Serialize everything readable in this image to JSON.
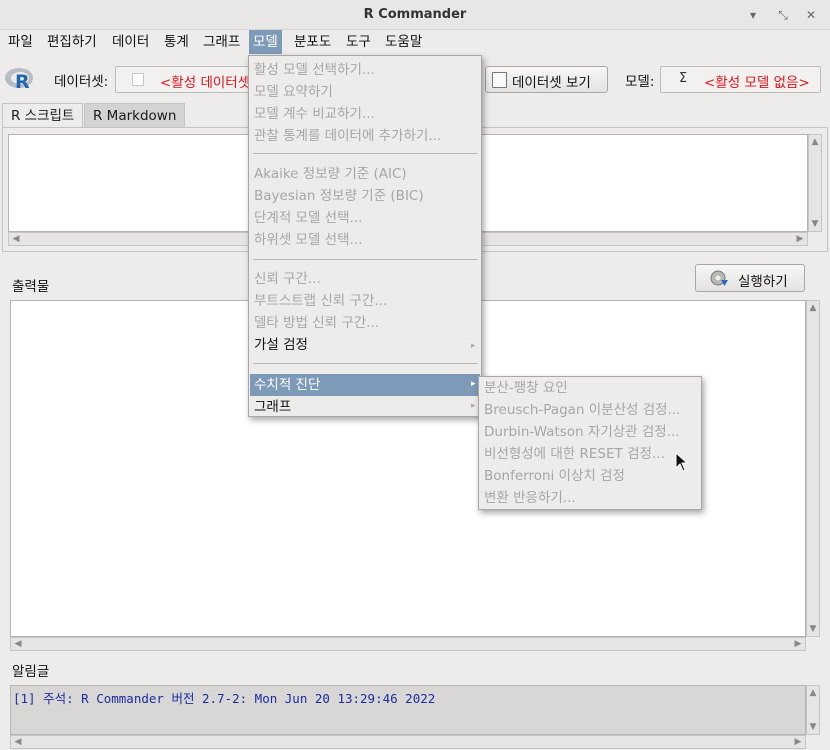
{
  "window": {
    "title": "R Commander",
    "controls": [
      "minimize-icon",
      "restore-icon",
      "close-icon"
    ]
  },
  "menubar": {
    "items": [
      "파일",
      "편집하기",
      "데이터",
      "통계",
      "그래프",
      "모델",
      "분포도",
      "도구",
      "도움말"
    ],
    "active_index": 5
  },
  "toolbar": {
    "dataset_label": "데이터셋:",
    "dataset_value": "<활성 데이터셋 없음>",
    "view_dataset_button": "데이터셋 보기",
    "model_label": "모델:",
    "model_value": "<활성 모델 없음>",
    "model_icon": "Σ"
  },
  "tabs": [
    {
      "label": "R 스크립트",
      "active": true
    },
    {
      "label": "R Markdown",
      "active": false
    }
  ],
  "output": {
    "label": "출력물",
    "run_button": "실행하기"
  },
  "notice": {
    "label": "알림글",
    "message": "[1] 주석: R Commander 버전 2.7-2: Mon Jun 20 13:29:46 2022"
  },
  "model_menu": {
    "groups": [
      [
        "활성 모델 선택하기...",
        "모델 요약하기",
        "모델 계수 비교하기...",
        "관찰 통계를 데이터에 추가하기..."
      ],
      [
        "Akaike 정보량 기준 (AIC)",
        "Bayesian 정보량 기준 (BIC)",
        "단계적 모델 선택...",
        "하위셋 모델 선택..."
      ],
      [
        "신뢰 구간...",
        "부트스트랩 신뢰 구간...",
        "델타 방법 신뢰 구간...",
        "가설 검정"
      ],
      [
        "수치적 진단",
        "그래프"
      ]
    ]
  },
  "diagnostics_submenu": {
    "items": [
      "분산-팽창 요인",
      "Breusch-Pagan 이분산성 검정...",
      "Durbin-Watson 자기상관 검정...",
      "비선형성에 대한 RESET 검정...",
      "Bonferroni 이상치 검정",
      "변환 반응하기..."
    ]
  },
  "colors": {
    "menu_highlight": "#7d9bb8",
    "disabled_text": "#a7a6a4",
    "placeholder_red": "#e0141b",
    "notice_text": "#1a2ea0"
  }
}
